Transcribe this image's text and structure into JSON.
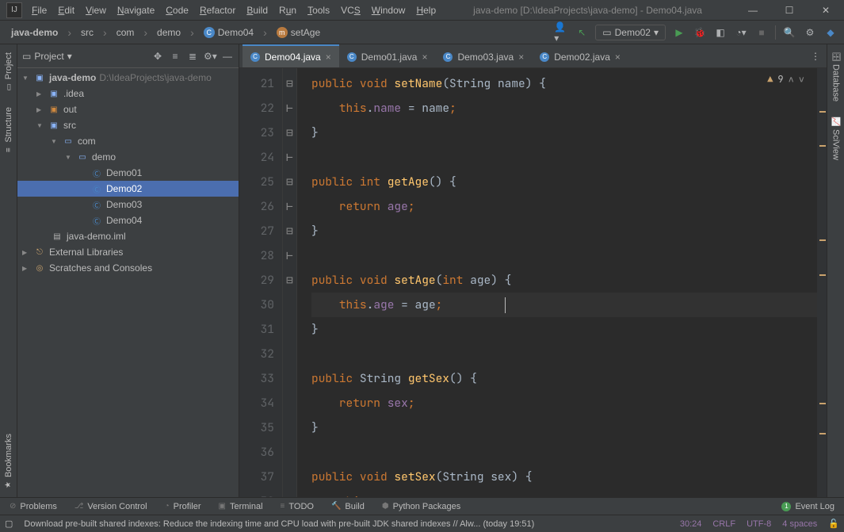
{
  "title": "java-demo [D:\\IdeaProjects\\java-demo] - Demo04.java",
  "menu": [
    "File",
    "Edit",
    "View",
    "Navigate",
    "Code",
    "Refactor",
    "Build",
    "Run",
    "Tools",
    "VCS",
    "Window",
    "Help"
  ],
  "breadcrumbs": [
    {
      "label": "java-demo",
      "icon": ""
    },
    {
      "label": "src",
      "icon": ""
    },
    {
      "label": "com",
      "icon": ""
    },
    {
      "label": "demo",
      "icon": ""
    },
    {
      "label": "Demo04",
      "icon": "class"
    },
    {
      "label": "setAge",
      "icon": "method"
    }
  ],
  "run_config": "Demo02",
  "tree": {
    "root": {
      "name": "java-demo",
      "path": "D:\\IdeaProjects\\java-demo"
    },
    "idea": ".idea",
    "out": "out",
    "src": "src",
    "com": "com",
    "demo": "demo",
    "files": [
      "Demo01",
      "Demo02",
      "Demo03",
      "Demo04"
    ],
    "iml": "java-demo.iml",
    "ext": "External Libraries",
    "scratch": "Scratches and Consoles"
  },
  "tabs": [
    {
      "name": "Demo04.java",
      "active": true
    },
    {
      "name": "Demo01.java",
      "active": false
    },
    {
      "name": "Demo03.java",
      "active": false
    },
    {
      "name": "Demo02.java",
      "active": false
    }
  ],
  "project_label": "Project",
  "inspections": {
    "warnings": "9"
  },
  "vtabs_left": [
    "Project",
    "Structure",
    "Bookmarks"
  ],
  "vtabs_right": [
    "Database",
    "SciView"
  ],
  "code_start_line": 21,
  "tool_buttons": {
    "problems": "Problems",
    "vcs": "Version Control",
    "profiler": "Profiler",
    "terminal": "Terminal",
    "todo": "TODO",
    "build": "Build",
    "python": "Python Packages",
    "event": "Event Log"
  },
  "status": {
    "msg": "Download pre-built shared indexes: Reduce the indexing time and CPU load with pre-built JDK shared indexes // Alw... (today 19:51)",
    "pos": "30:24",
    "eol": "CRLF",
    "enc": "UTF-8",
    "indent": "4 spaces"
  }
}
